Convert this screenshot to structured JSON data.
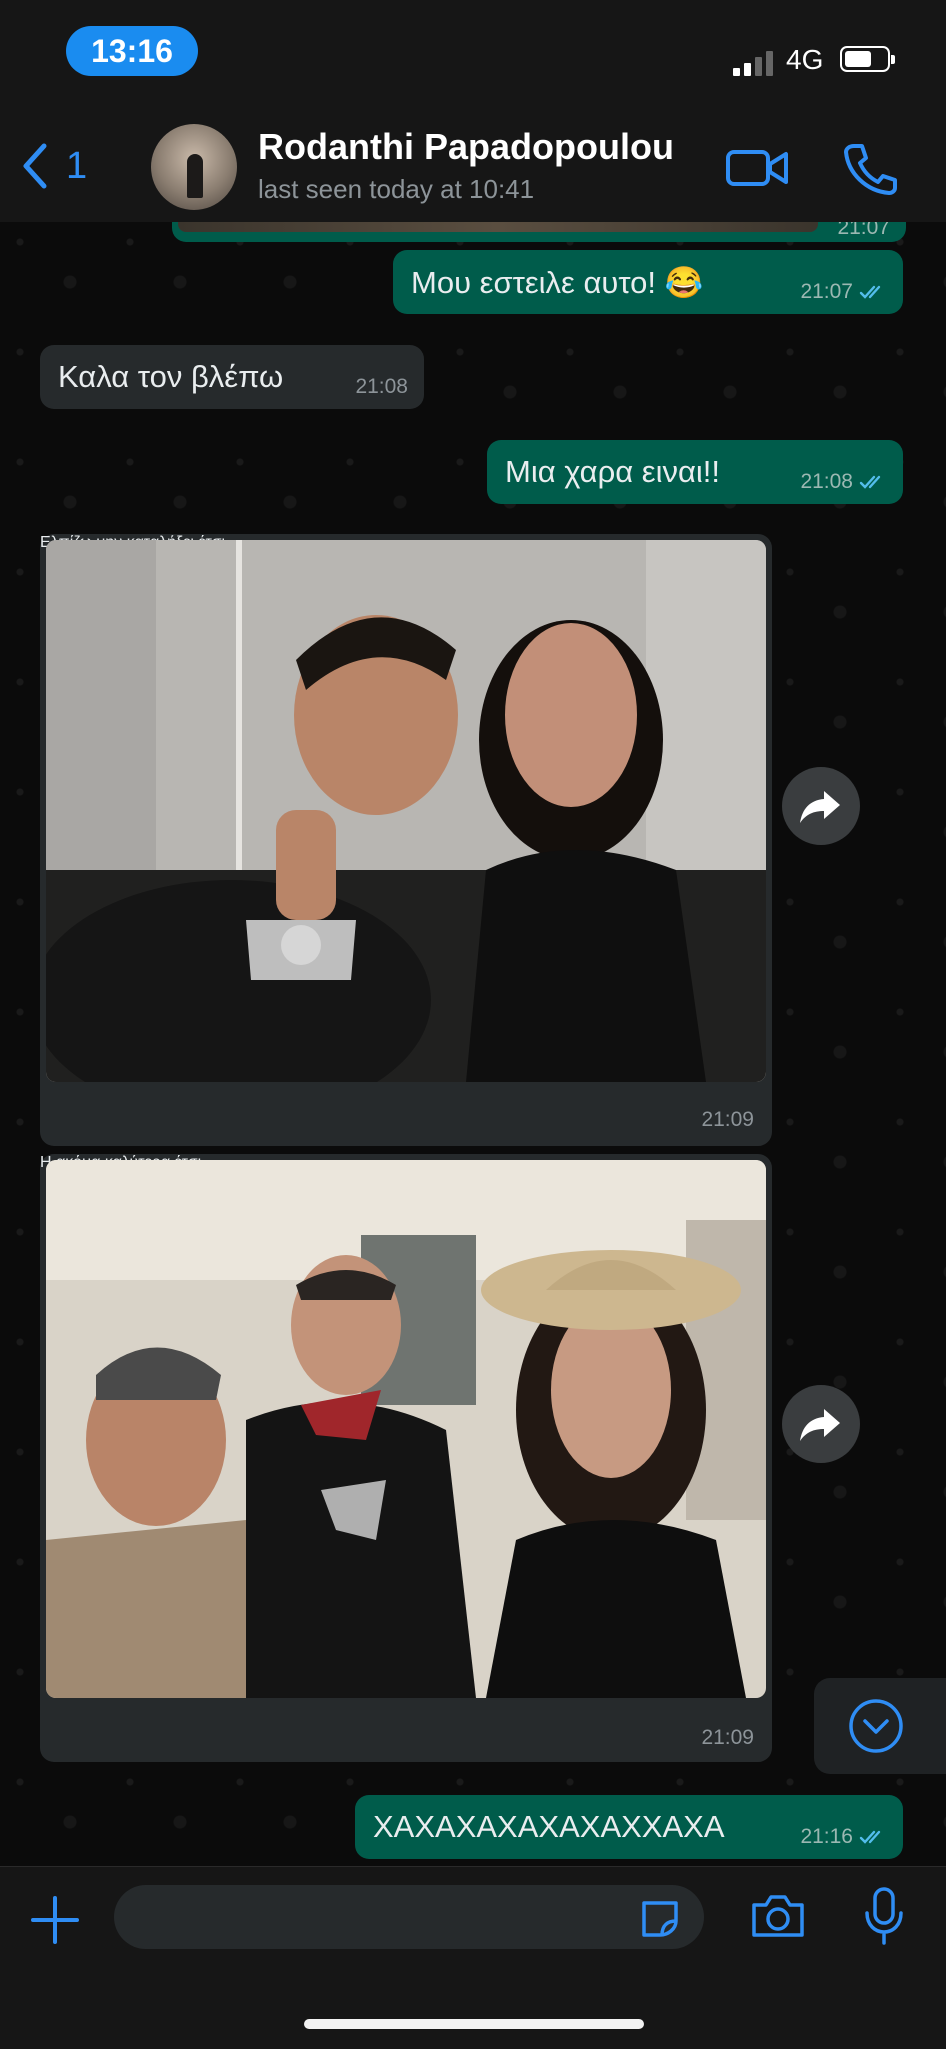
{
  "status_bar": {
    "time": "13:16",
    "network": "4G"
  },
  "header": {
    "back_count": "1",
    "contact_name": "Rodanthi Papadopoulou",
    "last_seen": "last seen today at 10:41"
  },
  "messages": [
    {
      "direction": "outgoing",
      "text": "Μου εστειλε αυτο! 😂",
      "time": "21:07",
      "read": true
    },
    {
      "direction": "incoming",
      "text": "Καλα τον βλέπω",
      "time": "21:08"
    },
    {
      "direction": "outgoing",
      "text": "Μια χαρα ειναι!!",
      "time": "21:08",
      "read": true
    },
    {
      "direction": "incoming",
      "type": "photo",
      "caption": "Ελπίζω μην καταλήξει έτσι",
      "time": "21:09"
    },
    {
      "direction": "incoming",
      "type": "photo",
      "caption": "Η ακόμα καλύτερα έτσι",
      "time": "21:09"
    },
    {
      "direction": "outgoing",
      "text": "ΧΑΧΑΧΑΧΑΧΑΧΑΧΧΑΧΑ",
      "time": "21:16",
      "read": true
    }
  ],
  "partial_top_message_time": "21:07",
  "colors": {
    "accent": "#2f8df4",
    "outgoing_bubble": "#005c4b",
    "incoming_bubble": "#262a2c",
    "read_tick": "#53bdeb"
  },
  "icons": [
    "back-chevron-icon",
    "video-call-icon",
    "voice-call-icon",
    "forward-icon",
    "scroll-down-icon",
    "plus-icon",
    "sticker-icon",
    "camera-icon",
    "microphone-icon"
  ]
}
